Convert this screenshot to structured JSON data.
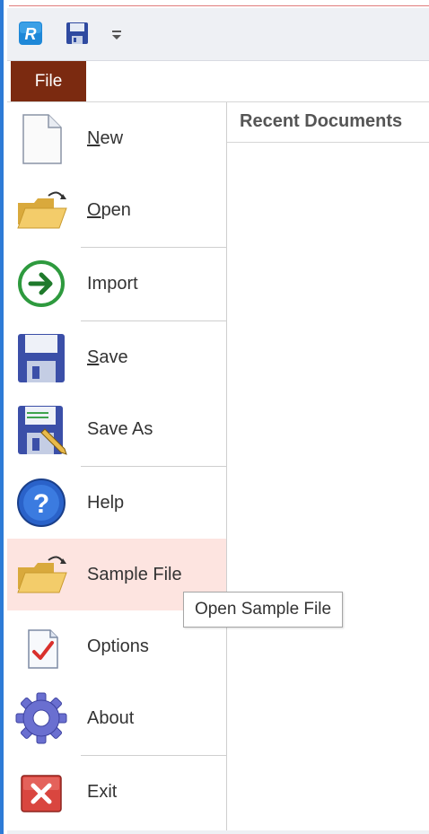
{
  "quick_access": {
    "app_icon": "app-r-icon",
    "save_icon": "save-icon",
    "customize_icon": "customize-qat-icon"
  },
  "ribbon": {
    "file_tab": "File"
  },
  "menu": {
    "items": [
      {
        "id": "new",
        "mnemonic": "N",
        "rest": "ew",
        "icon": "new-document-icon"
      },
      {
        "id": "open",
        "mnemonic": "O",
        "rest": "pen",
        "icon": "open-folder-icon"
      },
      {
        "id": "import",
        "label": "Import",
        "icon": "import-arrow-icon"
      },
      {
        "id": "save",
        "mnemonic": "S",
        "rest": "ave",
        "icon": "floppy-save-icon"
      },
      {
        "id": "save-as",
        "label": "Save As",
        "icon": "save-as-icon"
      },
      {
        "id": "help",
        "label": "Help",
        "icon": "help-icon"
      },
      {
        "id": "sample-file",
        "label": "Sample File",
        "icon": "sample-folder-icon"
      },
      {
        "id": "options",
        "label": "Options",
        "icon": "options-checkmark-icon"
      },
      {
        "id": "about",
        "label": "About",
        "icon": "gear-icon"
      },
      {
        "id": "exit",
        "label": "Exit",
        "icon": "exit-icon"
      }
    ]
  },
  "recent": {
    "title": "Recent Documents"
  },
  "tooltip": {
    "text": "Open Sample File"
  },
  "colors": {
    "file_tab_bg": "#7b2a10",
    "highlight_bg": "#fde4e0",
    "window_border": "#2d7bd6"
  }
}
